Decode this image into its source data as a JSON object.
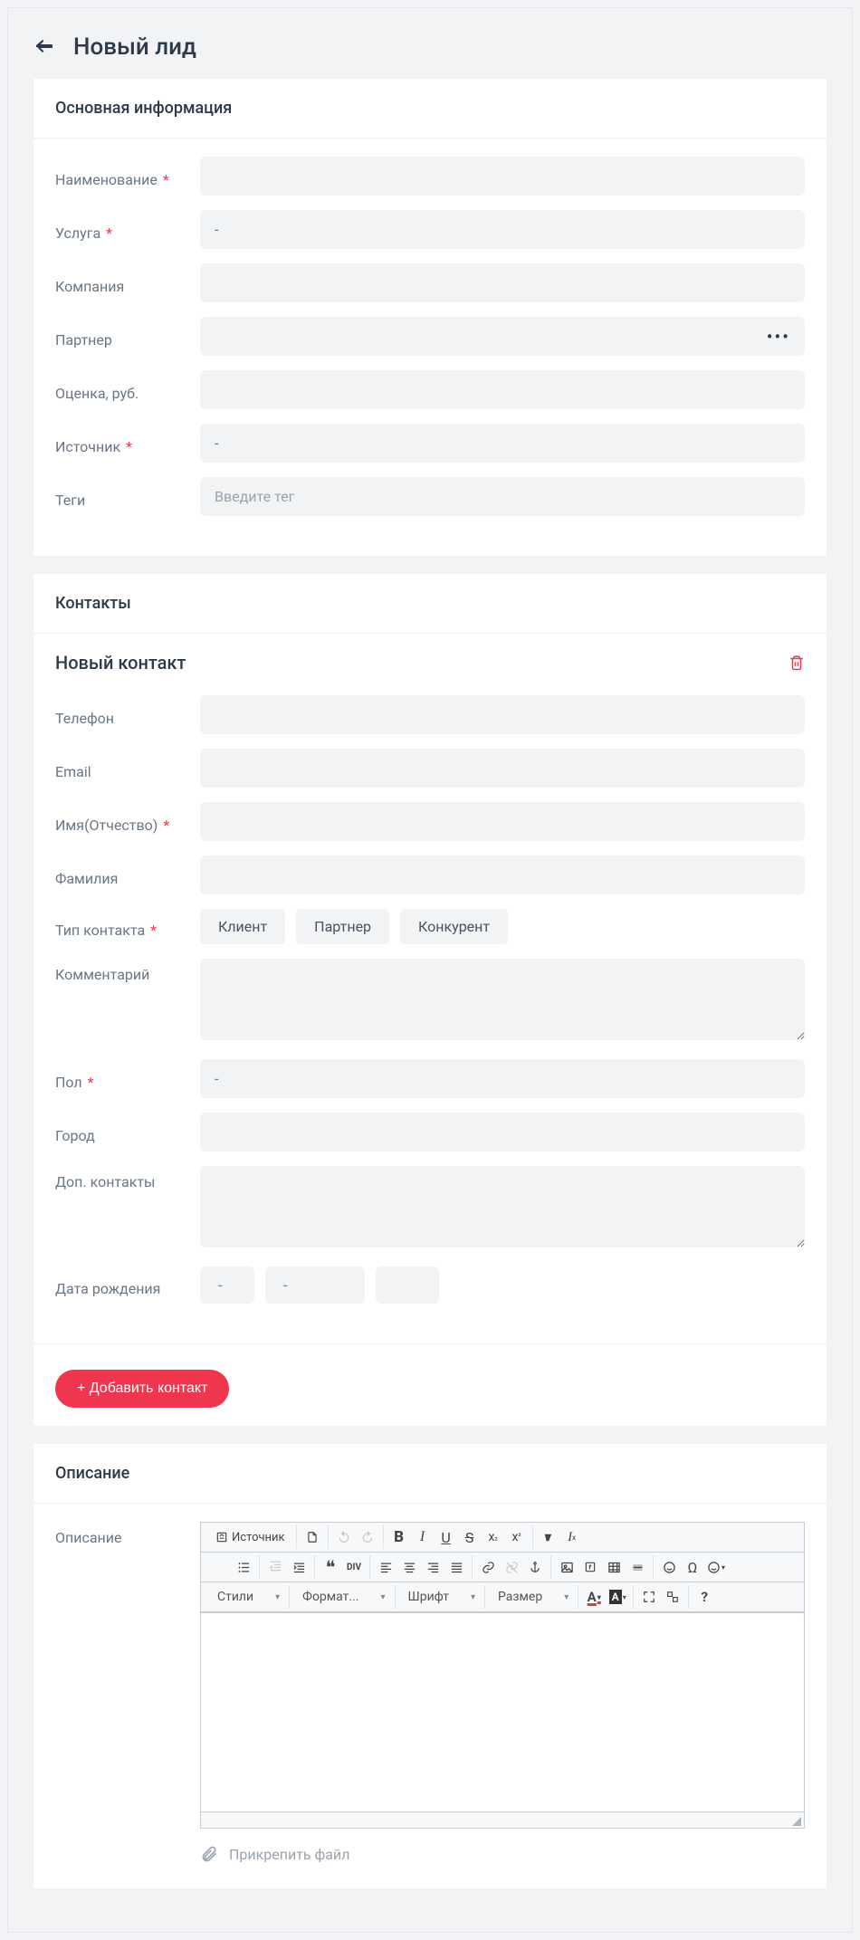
{
  "page": {
    "title": "Новый лид"
  },
  "sections": {
    "main": {
      "title": "Основная информация",
      "fields": {
        "name": {
          "label": "Наименование",
          "value": ""
        },
        "service": {
          "label": "Услуга",
          "value": "-"
        },
        "company": {
          "label": "Компания",
          "value": ""
        },
        "partner": {
          "label": "Партнер",
          "value": ""
        },
        "estimate": {
          "label": "Оценка, руб.",
          "value": ""
        },
        "source": {
          "label": "Источник",
          "value": "-"
        },
        "tags": {
          "label": "Теги",
          "placeholder": "Введите тег"
        }
      }
    },
    "contacts": {
      "title": "Контакты",
      "newContactTitle": "Новый контакт",
      "fields": {
        "phone": {
          "label": "Телефон"
        },
        "email": {
          "label": "Email"
        },
        "firstName": {
          "label": "Имя(Отчество)"
        },
        "lastName": {
          "label": "Фамилия"
        },
        "contactType": {
          "label": "Тип контакта",
          "options": [
            "Клиент",
            "Партнер",
            "Конкурент"
          ]
        },
        "comment": {
          "label": "Комментарий"
        },
        "gender": {
          "label": "Пол",
          "value": "-"
        },
        "city": {
          "label": "Город"
        },
        "extra": {
          "label": "Доп. контакты"
        },
        "birth": {
          "label": "Дата рождения",
          "day": "-",
          "month": "-",
          "year": ""
        }
      },
      "addButton": "+ Добавить контакт"
    },
    "description": {
      "title": "Описание",
      "label": "Описание",
      "attach": "Прикрепить файл",
      "editor": {
        "sourceButton": "Источник",
        "combos": {
          "styles": "Стили",
          "format": "Формат...",
          "font": "Шрифт",
          "size": "Размер"
        }
      }
    }
  }
}
